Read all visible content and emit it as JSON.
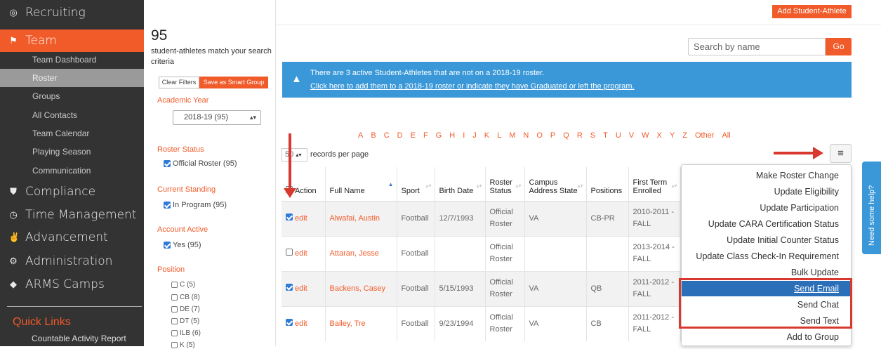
{
  "sidebar": {
    "main": [
      {
        "label": "Recruiting",
        "icon": "target-icon"
      },
      {
        "label": "Team",
        "icon": "flag-icon"
      },
      {
        "label": "Compliance",
        "icon": "shield-icon"
      },
      {
        "label": "Time Management",
        "icon": "clock-icon"
      },
      {
        "label": "Advancement",
        "icon": "handshake-icon"
      },
      {
        "label": "Administration",
        "icon": "gear-icon"
      },
      {
        "label": "ARMS Camps",
        "icon": "diamond-icon"
      }
    ],
    "team_sub": [
      "Team Dashboard",
      "Roster",
      "Groups",
      "All Contacts",
      "Team Calendar",
      "Playing Season",
      "Communication"
    ],
    "quick_links_title": "Quick Links",
    "quick_links": [
      "Countable Activity Report"
    ]
  },
  "filters": {
    "count": "95",
    "match_text": "student-athletes match your search criteria",
    "clear_label": "Clear Filters",
    "save_label": "Save as Smart Group",
    "academic_year_label": "Academic Year",
    "academic_year_value": "2018-19 (95)",
    "roster_status_label": "Roster Status",
    "roster_status_opt": "Official Roster (95)",
    "standing_label": "Current Standing",
    "standing_opt": "In Program (95)",
    "account_active_label": "Account Active",
    "account_active_opt": "Yes (95)",
    "position_label": "Position",
    "positions": [
      "C (5)",
      "CB (8)",
      "DE (7)",
      "DT (5)",
      "ILB (6)",
      "K (5)"
    ]
  },
  "header": {
    "add_label": "Add Student-Athlete",
    "search_placeholder": "Search by name",
    "go_label": "Go"
  },
  "alert": {
    "line1": "There are 3 active Student-Athletes that are not on a 2018-19 roster.",
    "line2": "Click here to add them to a 2018-19 roster or indicate they have Graduated or left the program."
  },
  "alphabet": [
    "A",
    "B",
    "C",
    "D",
    "E",
    "F",
    "G",
    "H",
    "I",
    "J",
    "K",
    "L",
    "M",
    "N",
    "O",
    "P",
    "Q",
    "R",
    "S",
    "T",
    "U",
    "V",
    "W",
    "X",
    "Y",
    "Z",
    "Other",
    "All"
  ],
  "per_page": {
    "value": "50",
    "label": "records per page"
  },
  "table": {
    "headers": [
      "Action",
      "Full Name",
      "Sport",
      "Birth Date",
      "Roster Status",
      "Campus Address State",
      "Positions",
      "First Term Enrolled"
    ],
    "rows": [
      {
        "checked": true,
        "action": "edit",
        "name": "Alwafai, Austin",
        "sport": "Football",
        "birth": "12/7/1993",
        "status": "Official Roster",
        "state": "VA",
        "pos": "CB-PR",
        "term": "2010-2011 - FALL"
      },
      {
        "checked": false,
        "action": "edit",
        "name": "Attaran, Jesse",
        "sport": "Football",
        "birth": "",
        "status": "Official Roster",
        "state": "",
        "pos": "",
        "term": "2013-2014 - FALL"
      },
      {
        "checked": true,
        "action": "edit",
        "name": "Backens, Casey",
        "sport": "Football",
        "birth": "5/15/1993",
        "status": "Official Roster",
        "state": "VA",
        "pos": "QB",
        "term": "2011-2012 - FALL"
      },
      {
        "checked": true,
        "action": "edit",
        "name": "Bailey, Tre",
        "sport": "Football",
        "birth": "9/23/1994",
        "status": "Official Roster",
        "state": "VA",
        "pos": "CB",
        "term": "2011-2012 - FALL"
      }
    ]
  },
  "menu": {
    "items": [
      "Make Roster Change",
      "Update Eligibility",
      "Update Participation",
      "Update CARA Certification Status",
      "Update Initial Counter Status",
      "Update Class Check-In Requirement",
      "Bulk Update",
      "Send Email",
      "Send Chat",
      "Send Text",
      "Add to Group"
    ],
    "selected": "Send Email"
  },
  "help_label": "Need some help?",
  "colors": {
    "accent": "#f15a29",
    "info": "#3a98d8",
    "sidebar": "#333333",
    "highlight": "#d9382e"
  }
}
